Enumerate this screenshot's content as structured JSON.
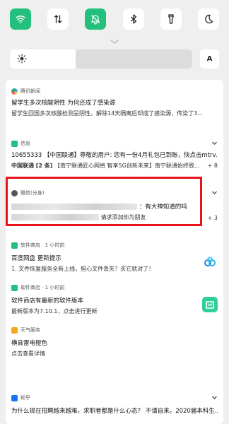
{
  "quick_settings": [
    {
      "name": "wifi-icon",
      "active": true
    },
    {
      "name": "mobile-data-icon",
      "active": false
    },
    {
      "name": "silent-mode-icon",
      "active": true
    },
    {
      "name": "bluetooth-icon",
      "active": false
    },
    {
      "name": "flashlight-icon",
      "active": false
    },
    {
      "name": "dark-mode-icon",
      "active": false
    }
  ],
  "brightness": {
    "level": 0.36,
    "auto_label": "A"
  },
  "notifications": {
    "tencent": {
      "app": "腾讯新闻",
      "title": "留学生多次核酸阴性 为何还成了感染源",
      "body": "留学生回国多次核酸检测呈阴性，解除14天隔离后却成了感染源，传染了3..."
    },
    "sms": {
      "app": "信息",
      "line1": "10655333 【中国联通】尊敬的用户: 您有一份4月礼包已到账，快点击mtrv.c...",
      "line2_sender": "中国联通 [2 条]",
      "line2_text": "【南宁联通匠心网络 智享5G创新未来】南宁联通始终致...",
      "count": "+ 8"
    },
    "wechat": {
      "app": "微信(分身)",
      "line1": "：有大神知道的吗",
      "line2": "请求添加你为朋友",
      "count": "+ 3"
    },
    "appstore1": {
      "app": "软件商店 · 1 小时前",
      "title": "百度网盘 更新提示",
      "body": "1.      文件恢复服务全新上线，担心文件丢失？买它就对了！"
    },
    "appstore2": {
      "app": "软件商店 · 1 小时前",
      "title": "软件商店有最新的软件版本",
      "body": "最新版本为7.10.1，点击进行更新"
    },
    "weather": {
      "app": "天气服务",
      "title": "横县雷电橙色",
      "body": "点击查看详情"
    },
    "zhihu": {
      "app": "知乎",
      "title": "为什么现在招聘越来越难，求职者都是什么心态？ 不请自来。2020届本科生..."
    }
  },
  "colors": {
    "accent_green": "#22c07c",
    "highlight_red": "#e8141c"
  }
}
